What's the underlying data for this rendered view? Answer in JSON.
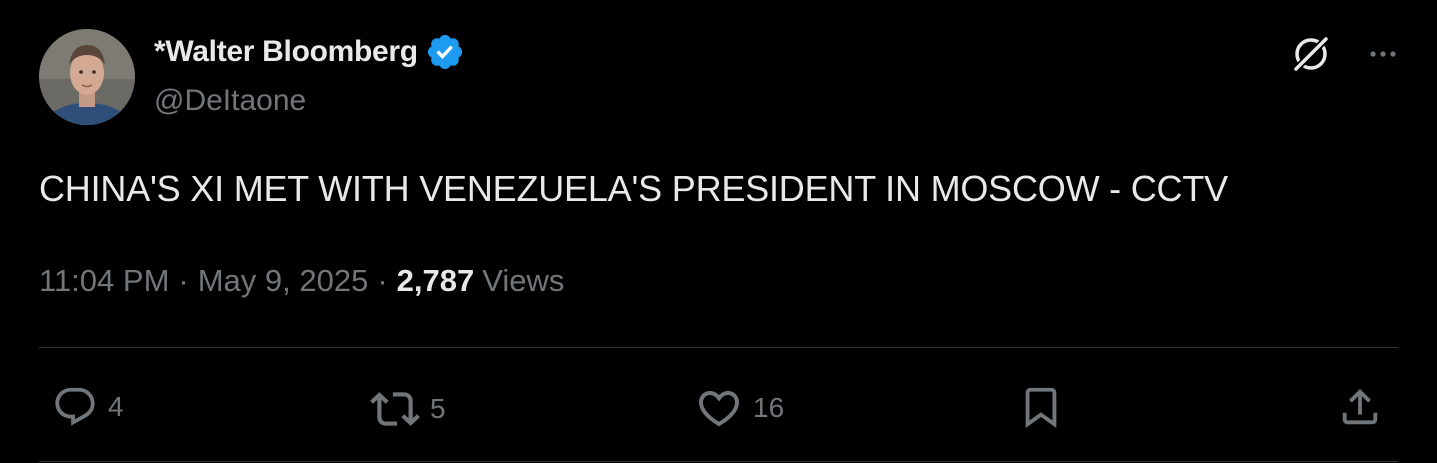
{
  "author": {
    "display_name": "*Walter Bloomberg",
    "handle": "@DeItaone",
    "verified": true
  },
  "tweet": {
    "text": "CHINA'S XI MET WITH VENEZUELA'S PRESIDENT IN MOSCOW - CCTV",
    "time": "11:04 PM",
    "separator": "·",
    "date": "May 9, 2025",
    "views_count": "2,787",
    "views_label": "Views"
  },
  "actions": {
    "replies": "4",
    "reposts": "5",
    "likes": "16"
  },
  "icons": {
    "top": [
      "grok-icon",
      "more-icon"
    ],
    "bottom": [
      "reply-icon",
      "repost-icon",
      "like-icon",
      "bookmark-icon",
      "share-icon"
    ]
  },
  "colors": {
    "background": "#000000",
    "text_primary": "#e7e9ea",
    "text_secondary": "#71767b",
    "verified_blue": "#1d9bf0",
    "divider": "#2f3336"
  }
}
